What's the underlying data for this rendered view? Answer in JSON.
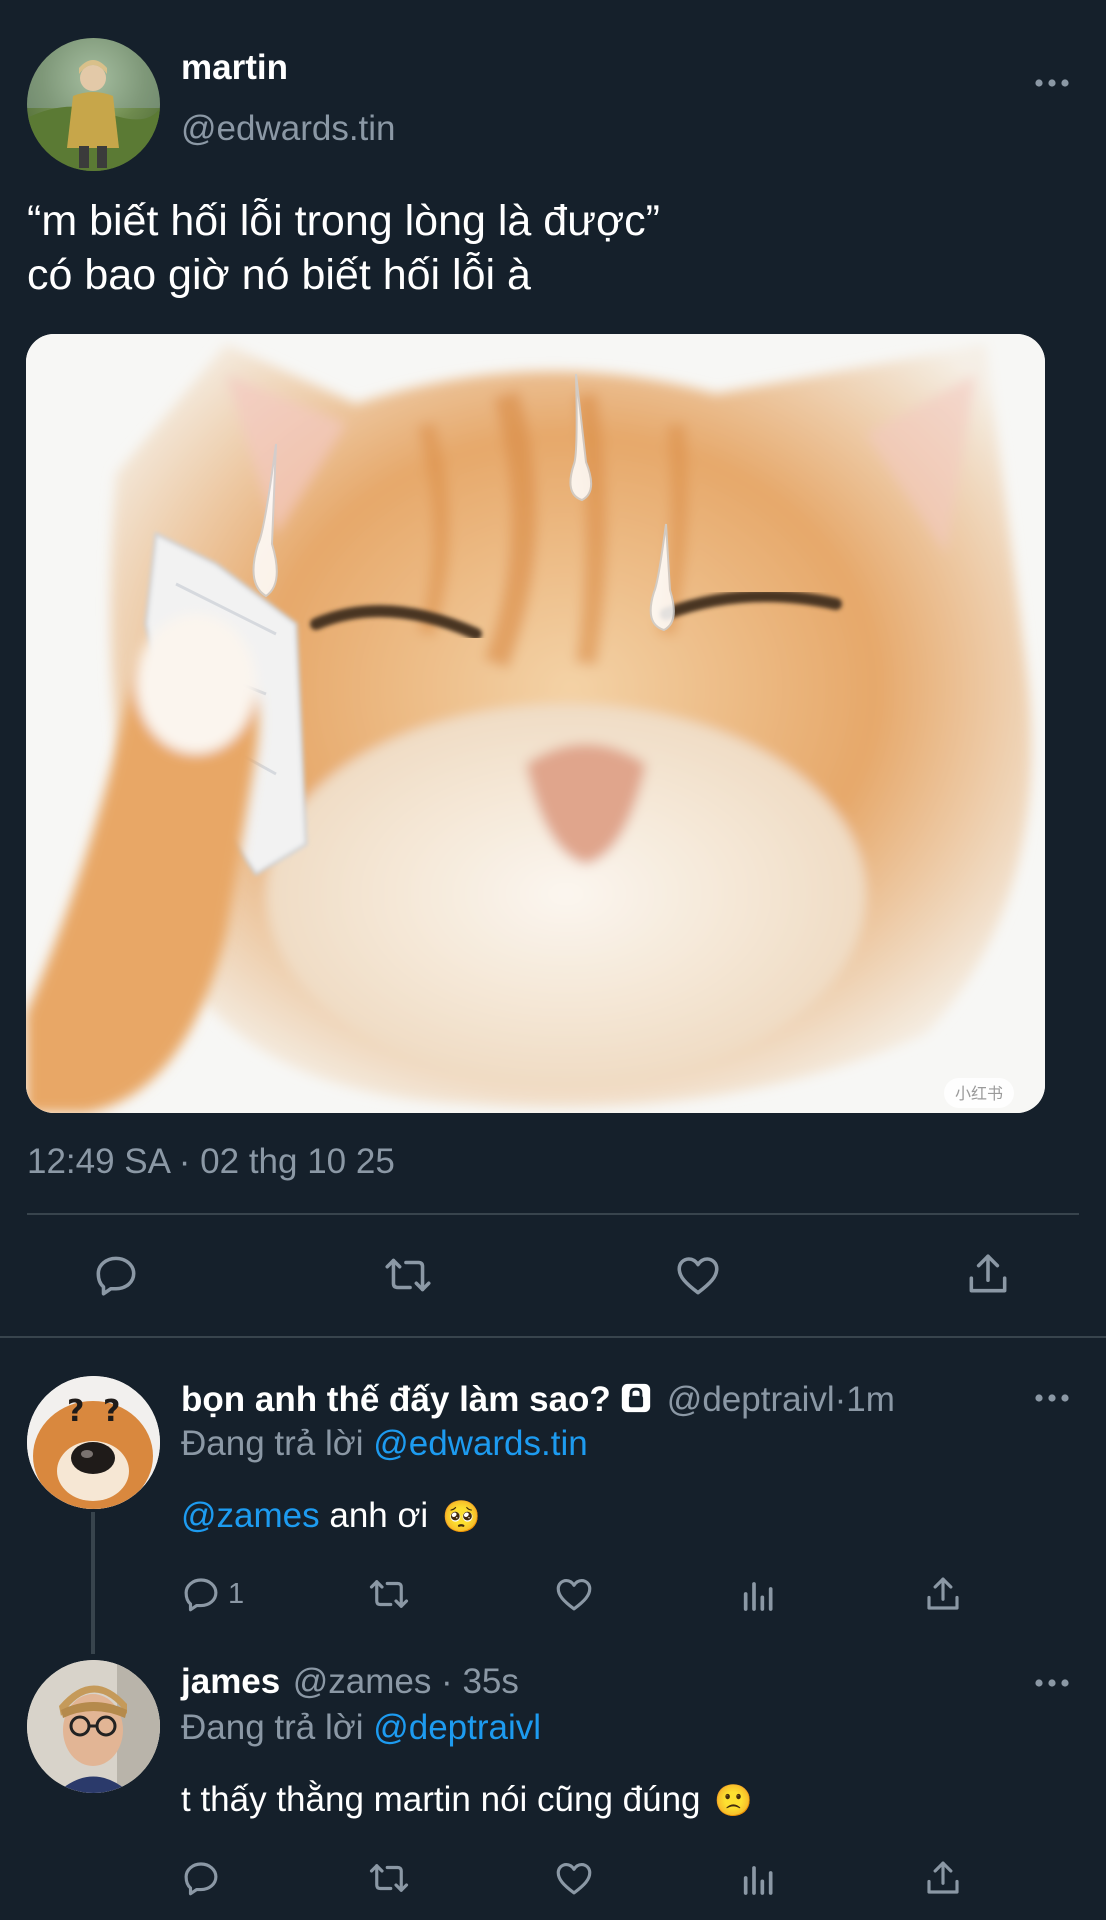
{
  "main_tweet": {
    "display_name": "martin",
    "handle": "@edwards.tin",
    "more_icon": "more-horizontal-icon",
    "text_line1": "“m biết hối lỗi trong lòng là được”",
    "text_line2": "có bao giờ nó biết hối lỗi à",
    "media_watermark": "小红书",
    "timestamp": "12:49 SA · 02 thg 10 25",
    "actions": [
      "reply-icon",
      "retweet-icon",
      "like-icon",
      "share-icon"
    ]
  },
  "replies": [
    {
      "display_name": "bọn anh thế đấy làm sao?",
      "locked": true,
      "handle": "@deptraivl",
      "sep": " · ",
      "time": "1m",
      "replying_prefix": "Đang trả lời ",
      "replying_to": "@edwards.tin",
      "mention": "@zames",
      "text": " anh ơi",
      "emoji": "🥺",
      "reply_count": "1"
    },
    {
      "display_name": "james",
      "handle": "@zames",
      "sep": " · ",
      "time": "35s",
      "replying_prefix": "Đang trả lời ",
      "replying_to": "@deptraivl",
      "text": "t thấy thằng martin nói cũng đúng",
      "emoji": "🙁"
    }
  ],
  "colors": {
    "background": "#15202b",
    "secondary_text": "#8b98a5",
    "link": "#1d9bf0",
    "divider": "#38444d"
  }
}
